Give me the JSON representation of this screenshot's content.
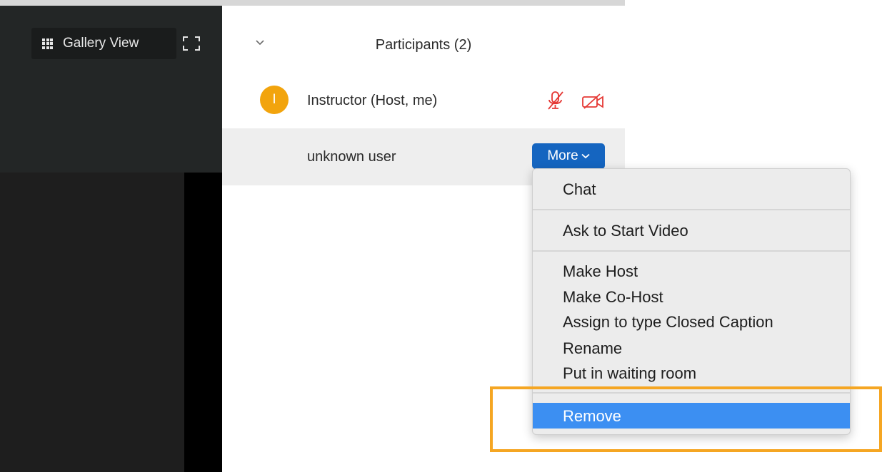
{
  "toolbar": {
    "gallery_view_label": "Gallery View"
  },
  "participants": {
    "title": "Participants (2)",
    "rows": [
      {
        "avatar_initial": "I",
        "name": "Instructor (Host, me)",
        "avatar_color": "#f2a40d"
      },
      {
        "name": "unknown user",
        "more_label": "More"
      }
    ]
  },
  "menu": {
    "items": [
      {
        "label": "Chat"
      },
      {
        "label": "Ask to Start Video"
      },
      {
        "label": "Make Host"
      },
      {
        "label": "Make Co-Host"
      },
      {
        "label": "Assign to type Closed Caption"
      },
      {
        "label": "Rename"
      },
      {
        "label": "Put in waiting room"
      },
      {
        "label": "Remove",
        "highlighted": true
      }
    ]
  },
  "icons": {
    "mute": "microphone-muted-icon",
    "video_off": "video-off-icon",
    "gallery": "grid-icon",
    "fullscreen": "fullscreen-icon"
  },
  "colors": {
    "accent_blue": "#1565c0",
    "menu_highlight": "#3c8ff2",
    "muted_red": "#e53935",
    "callout_orange": "#f5a623"
  }
}
